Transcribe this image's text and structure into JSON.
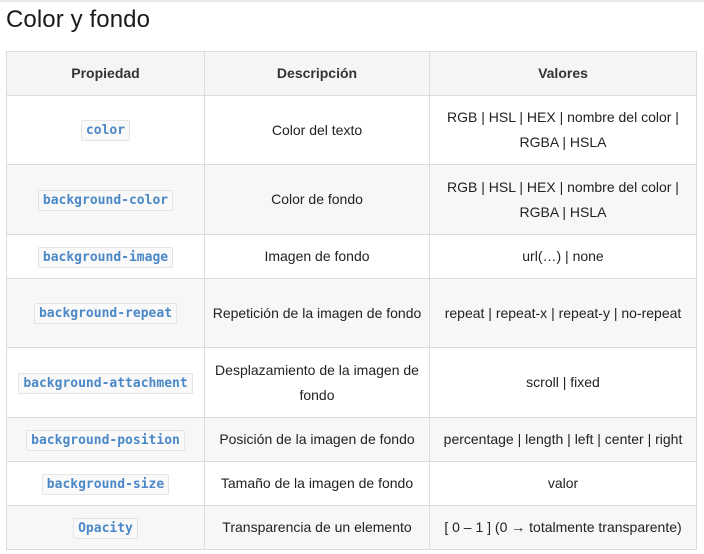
{
  "page": {
    "title": "Color y fondo"
  },
  "table": {
    "headers": {
      "property": "Propiedad",
      "description": "Descripción",
      "values": "Valores"
    },
    "rows": [
      {
        "property": "color",
        "description": "Color del texto",
        "values": "RGB | HSL | HEX | nombre del color | RGBA | HSLA"
      },
      {
        "property": "background-color",
        "description": "Color de fondo",
        "values": "RGB | HSL | HEX | nombre del color | RGBA | HSLA"
      },
      {
        "property": "background-image",
        "description": "Imagen de fondo",
        "values": "url(…) | none"
      },
      {
        "property": "background-repeat",
        "description": "Repetición de la imagen de fondo",
        "values": "repeat | repeat-x | repeat-y | no-repeat"
      },
      {
        "property": "background-attachment",
        "description": "Desplazamiento de la imagen de fondo",
        "values": "scroll | fixed"
      },
      {
        "property": "background-position",
        "description": "Posición de la imagen de fondo",
        "values": "percentage | length | left | center | right"
      },
      {
        "property": "background-size",
        "description": "Tamaño de la imagen de fondo",
        "values": "valor"
      },
      {
        "property": "Opacity",
        "description": "Transparencia de un elemento",
        "values": "[ 0 – 1 ] (0 → totalmente transparente)"
      }
    ]
  },
  "colors": {
    "code_text": "#4a88c7",
    "header_bg": "#f5f5f5",
    "border": "#dcdcdc"
  }
}
